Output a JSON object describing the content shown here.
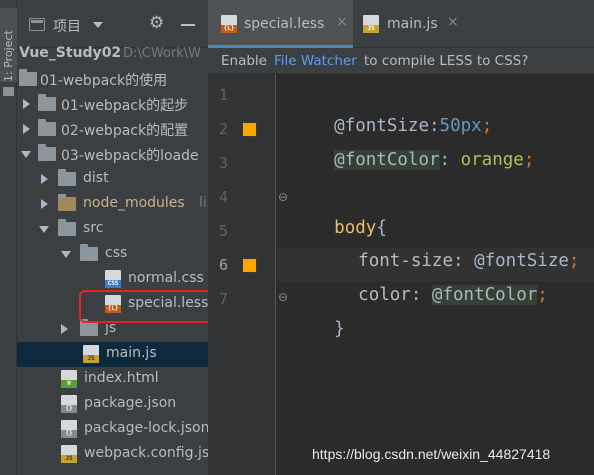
{
  "colors": {
    "orange_swatch": "#ffa500",
    "selection": "#0d293e",
    "link": "#589df6",
    "annotation_box": "#e3251b"
  },
  "toolstrip": {
    "project_label": "1: Project"
  },
  "project_panel": {
    "title": "项目",
    "tree": [
      {
        "label": "Vue_Study02",
        "suffix": "D:\\CWork\\W"
      },
      {
        "label": "01-webpack的使用"
      },
      {
        "label": "01-webpack的起步"
      },
      {
        "label": "02-webpack的配置"
      },
      {
        "label": "03-webpack的loade"
      },
      {
        "label": "dist"
      },
      {
        "label": "node_modules",
        "suffix": "li"
      },
      {
        "label": "src"
      },
      {
        "label": "css"
      },
      {
        "label": "normal.css",
        "icon": "CSS"
      },
      {
        "label": "special.less",
        "icon": "{L}"
      },
      {
        "label": "js"
      },
      {
        "label": "main.js",
        "icon": "JS"
      },
      {
        "label": "index.html",
        "icon": "H"
      },
      {
        "label": "package.json",
        "icon": "{}"
      },
      {
        "label": "package-lock.json",
        "icon": "{}"
      },
      {
        "label": "webpack.config.js",
        "icon": "JS"
      }
    ]
  },
  "editor": {
    "tabs": [
      {
        "label": "special.less",
        "icon": "{L}",
        "close": "×"
      },
      {
        "label": "main.js",
        "icon": "JS",
        "close": "×"
      }
    ],
    "notice": {
      "prefix": "Enable ",
      "link": "File Watcher",
      "suffix": " to compile LESS to CSS?"
    },
    "line_numbers": [
      "1",
      "2",
      "3",
      "4",
      "5",
      "6",
      "7"
    ],
    "code": {
      "l1_var": "@fontSize",
      "l1_colon": ":",
      "l1_value": "50px",
      "l1_semi": ";",
      "l2_var": "@fontColor",
      "l2_colon": ": ",
      "l2_value": "orange",
      "l2_semi": ";",
      "l4_selector": "body",
      "l4_brace": "{",
      "l5_prop": "font-size",
      "l5_colon": ": ",
      "l5_value": "@fontSize",
      "l5_semi": ";",
      "l6_prop": "color",
      "l6_colon": ": ",
      "l6_value": "@fontColor",
      "l6_semi": ";",
      "l7_brace": "}"
    }
  },
  "watermark": "https://blog.csdn.net/weixin_44827418"
}
